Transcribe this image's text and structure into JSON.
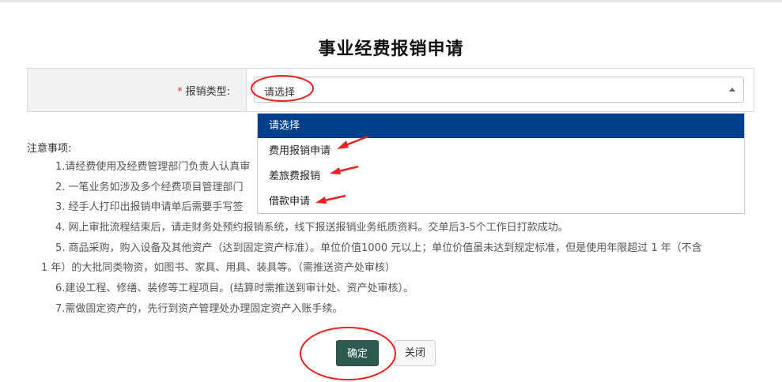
{
  "page": {
    "title": "事业经费报销申请"
  },
  "form": {
    "required_mark": "*",
    "type_label": "报销类型:",
    "select_value": "请选择"
  },
  "dropdown": {
    "options": [
      "请选择",
      "费用报销申请",
      "差旅费报销",
      "借款申请"
    ],
    "selected_index": 0
  },
  "notes": {
    "title": "注意事项:",
    "items": [
      "1.请经费使用及经费管理部门负责人认真审",
      "2. 一笔业务如涉及多个经费项目管理部门",
      "3. 经手人打印出报销申请单后需要手写签",
      "4. 网上审批流程结束后，请走财务处预约报销系统，线下报送报销业务纸质资料。交单后3-5个工作日打款成功。",
      "5. 商品采购，购入设备及其他资产（达到固定资产标准）。单位价值1000 元以上；单位价值虽未达到规定标准，但是使用年限超过 1 年（不含",
      "1 年）的大批同类物资，如图书、家具、用具、装具等。（需推送资产处审核）",
      "6.建设工程、修缮、装修等工程项目。(结算时需推送到审计处、资产处审核）。",
      "7.需做固定资产的，先行到资产管理处办理固定资产入账手续。"
    ]
  },
  "buttons": {
    "ok": "确定",
    "close": "关闭"
  },
  "annotation_color": "#e8231f",
  "selected_color": "#003f8a",
  "ok_button_color": "#2d5a50"
}
